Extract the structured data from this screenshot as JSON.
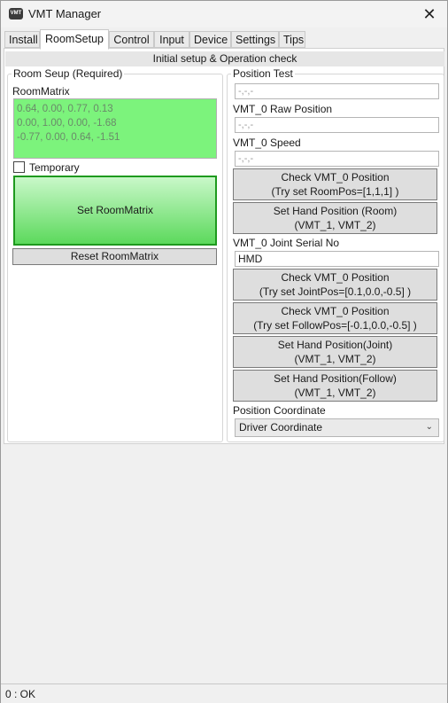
{
  "window": {
    "title": "VMT Manager",
    "icon": "VMT",
    "close_glyph": "✕"
  },
  "tabs": [
    {
      "label": "Install",
      "active": false
    },
    {
      "label": "RoomSetup",
      "active": true
    },
    {
      "label": "Control",
      "active": false
    },
    {
      "label": "Input",
      "active": false
    },
    {
      "label": "Device",
      "active": false
    },
    {
      "label": "Settings",
      "active": false
    },
    {
      "label": "Tips",
      "active": false
    }
  ],
  "banner": "Initial setup & Operation check",
  "room_setup": {
    "group_title": "Room Seup (Required)",
    "matrix_label": "RoomMatrix",
    "matrix_rows": [
      "0.64, 0.00, 0.77, 0.13",
      "0.00, 1.00, 0.00, -1.68",
      "-0.77, 0.00, 0.64, -1.51"
    ],
    "temporary_label": "Temporary",
    "temporary_checked": false,
    "set_button": "Set RoomMatrix",
    "reset_button": "Reset RoomMatrix"
  },
  "position_test": {
    "group_title": "Position Test",
    "field1_value": "-,-,-",
    "raw_label": "VMT_0 Raw Position",
    "raw_value": "-,-,-",
    "speed_label": "VMT_0 Speed",
    "speed_value": "-,-,-",
    "check_room": [
      "Check VMT_0 Position",
      "(Try set RoomPos=[1,1,1] )"
    ],
    "set_hand_room": [
      "Set Hand Position (Room)",
      "(VMT_1, VMT_2)"
    ],
    "joint_serial_label": "VMT_0 Joint Serial No",
    "joint_serial_value": "HMD",
    "check_joint": [
      "Check VMT_0 Position",
      "(Try set JointPos=[0.1,0.0,-0.5] )"
    ],
    "check_follow": [
      "Check VMT_0 Position",
      "(Try set FollowPos=[-0.1,0.0,-0.5] )"
    ],
    "set_hand_joint": [
      "Set Hand Position(Joint)",
      "(VMT_1, VMT_2)"
    ],
    "set_hand_follow": [
      "Set Hand Position(Follow)",
      "(VMT_1, VMT_2)"
    ],
    "coord_label": "Position Coordinate",
    "coord_value": "Driver Coordinate"
  },
  "status": "0 : OK",
  "colors": {
    "matrix_bg": "#7cf37c",
    "set_button_border": "#1e9a1e"
  }
}
